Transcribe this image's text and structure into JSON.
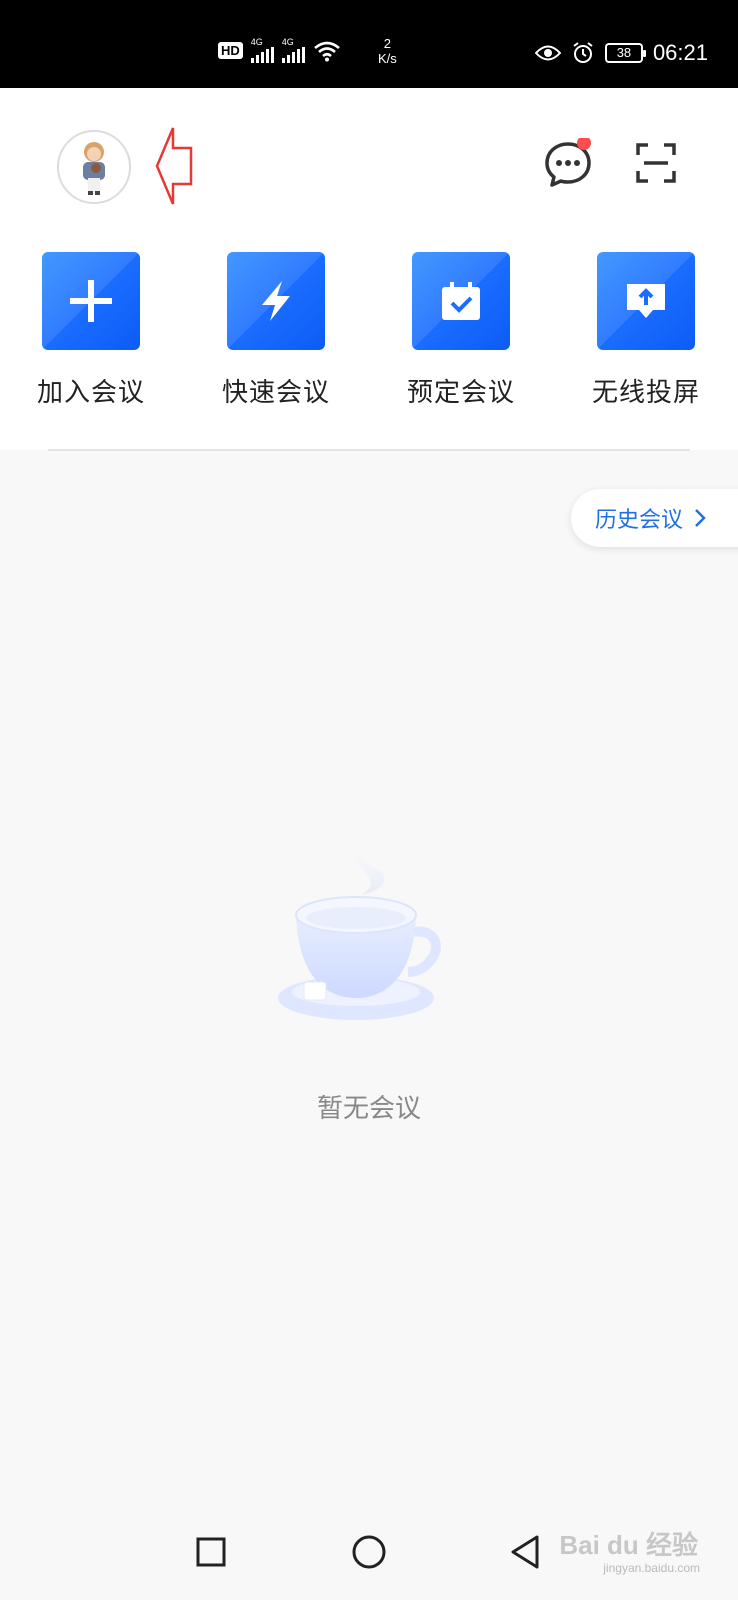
{
  "status_bar": {
    "hd": "HD",
    "sim1_label": "4G",
    "sim2_label": "4G",
    "speed_value": "2",
    "speed_unit": "K/s",
    "battery": "38",
    "time": "06:21"
  },
  "header": {
    "avatar_icon": "avatar-image",
    "annotation_arrow_color": "#e53935",
    "chat_icon": "chat-bubble-icon",
    "chat_badge_color": "#ff4d4f",
    "scan_icon": "scan-icon"
  },
  "actions": [
    {
      "label": "加入会议",
      "icon": "plus-icon"
    },
    {
      "label": "快速会议",
      "icon": "lightning-icon"
    },
    {
      "label": "预定会议",
      "icon": "calendar-check-icon"
    },
    {
      "label": "无线投屏",
      "icon": "screen-cast-icon"
    }
  ],
  "accent_color": "#1a6dff",
  "history": {
    "label": "历史会议",
    "icon": "chevron-right-icon"
  },
  "empty_state": {
    "illustration": "coffee-cup-illustration",
    "text": "暂无会议"
  },
  "nav": {
    "recent": "square-icon",
    "home": "circle-icon",
    "back": "triangle-back-icon"
  },
  "watermark": {
    "brand": "Bai du 经验",
    "url": "jingyan.baidu.com"
  }
}
